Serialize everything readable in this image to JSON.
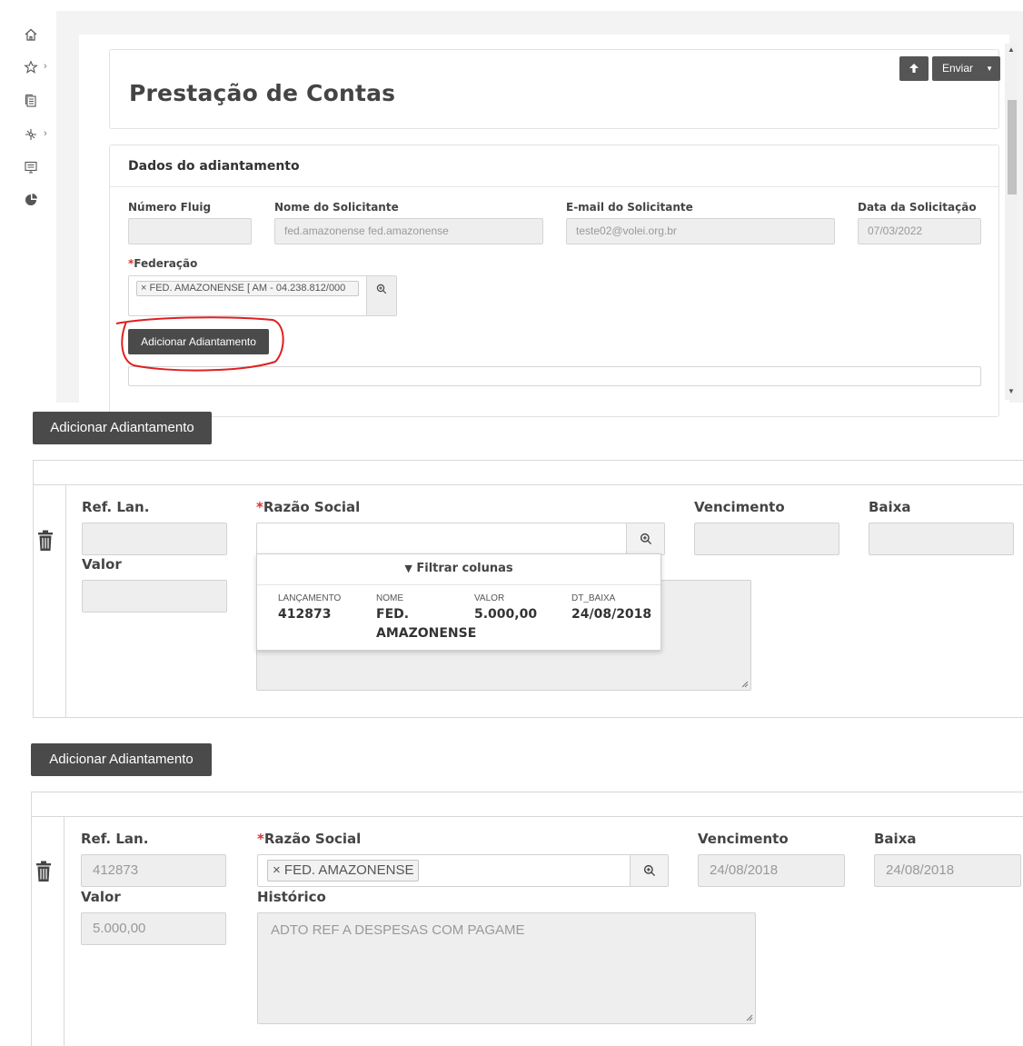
{
  "nav": {
    "icons": [
      "home-icon",
      "star-icon",
      "documents-icon",
      "workflow-icon",
      "monitor-icon",
      "analytics-icon"
    ]
  },
  "header": {
    "title": "Prestação de Contas",
    "send_label": "Enviar"
  },
  "form": {
    "section_title": "Dados do adiantamento",
    "fields": {
      "numero_fluig": {
        "label": "Número Fluig",
        "value": ""
      },
      "nome_solicitante": {
        "label": "Nome do Solicitante",
        "value": "fed.amazonense fed.amazonense"
      },
      "email_solicitante": {
        "label": "E-mail do Solicitante",
        "value": "teste02@volei.org.br"
      },
      "data_solicitacao": {
        "label": "Data da Solicitação",
        "value": "07/03/2022"
      }
    },
    "federacao": {
      "required_mark": "*",
      "label": "Federação",
      "tag": "× FED. AMAZONENSE [ AM - 04.238.812/000"
    },
    "add_button": "Adicionar Adiantamento"
  },
  "panel2": {
    "add_button": "Adicionar Adiantamento",
    "labels": {
      "ref_lan": "Ref. Lan.",
      "razao_required": "*",
      "razao_social": "Razão Social",
      "vencimento": "Vencimento",
      "baixa": "Baixa",
      "valor": "Valor"
    },
    "dropdown": {
      "filter_label": "Filtrar colunas",
      "columns": [
        "LANÇAMENTO",
        "NOME",
        "VALOR",
        "DT_BAIXA"
      ],
      "row": {
        "lancamento": "412873",
        "nome_line1": "FED.",
        "nome_line2": "AMAZONENSE",
        "valor": "5.000,00",
        "dt_baixa": "24/08/2018"
      }
    }
  },
  "panel3": {
    "add_button": "Adicionar Adiantamento",
    "labels": {
      "ref_lan": "Ref. Lan.",
      "razao_required": "*",
      "razao_social": "Razão Social",
      "vencimento": "Vencimento",
      "baixa": "Baixa",
      "valor": "Valor",
      "historico": "Histórico"
    },
    "values": {
      "ref_lan": "412873",
      "razao_tag": "× FED. AMAZONENSE",
      "vencimento": "24/08/2018",
      "baixa": "24/08/2018",
      "valor": "5.000,00",
      "historico": "ADTO REF A DESPESAS COM PAGAME"
    }
  },
  "colors": {
    "button_dark": "#4a4a4a",
    "required": "#e03030",
    "annotation": "#e02020"
  }
}
